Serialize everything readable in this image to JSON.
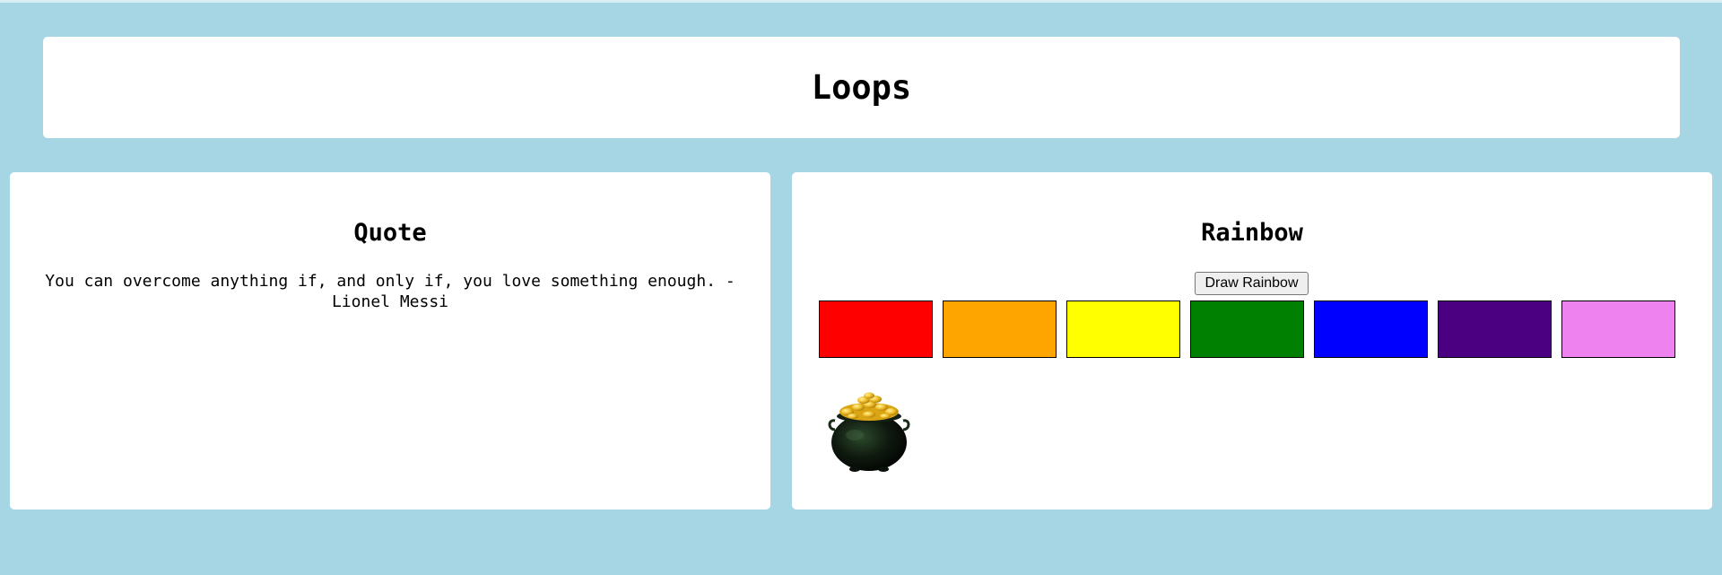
{
  "header": {
    "title": "Loops"
  },
  "quote": {
    "title": "Quote",
    "text": "You can overcome anything if, and only if, you love something enough. - Lionel Messi"
  },
  "rainbow": {
    "title": "Rainbow",
    "button_label": "Draw Rainbow",
    "stripes": [
      {
        "color": "#ff0000"
      },
      {
        "color": "#ffa500"
      },
      {
        "color": "#ffff00"
      },
      {
        "color": "#008000"
      },
      {
        "color": "#0000ff"
      },
      {
        "color": "#4b0082"
      },
      {
        "color": "#ee82ee"
      }
    ],
    "pot_icon": "pot-of-gold-icon"
  },
  "colors": {
    "background": "#a6d6e3",
    "card": "#ffffff"
  }
}
